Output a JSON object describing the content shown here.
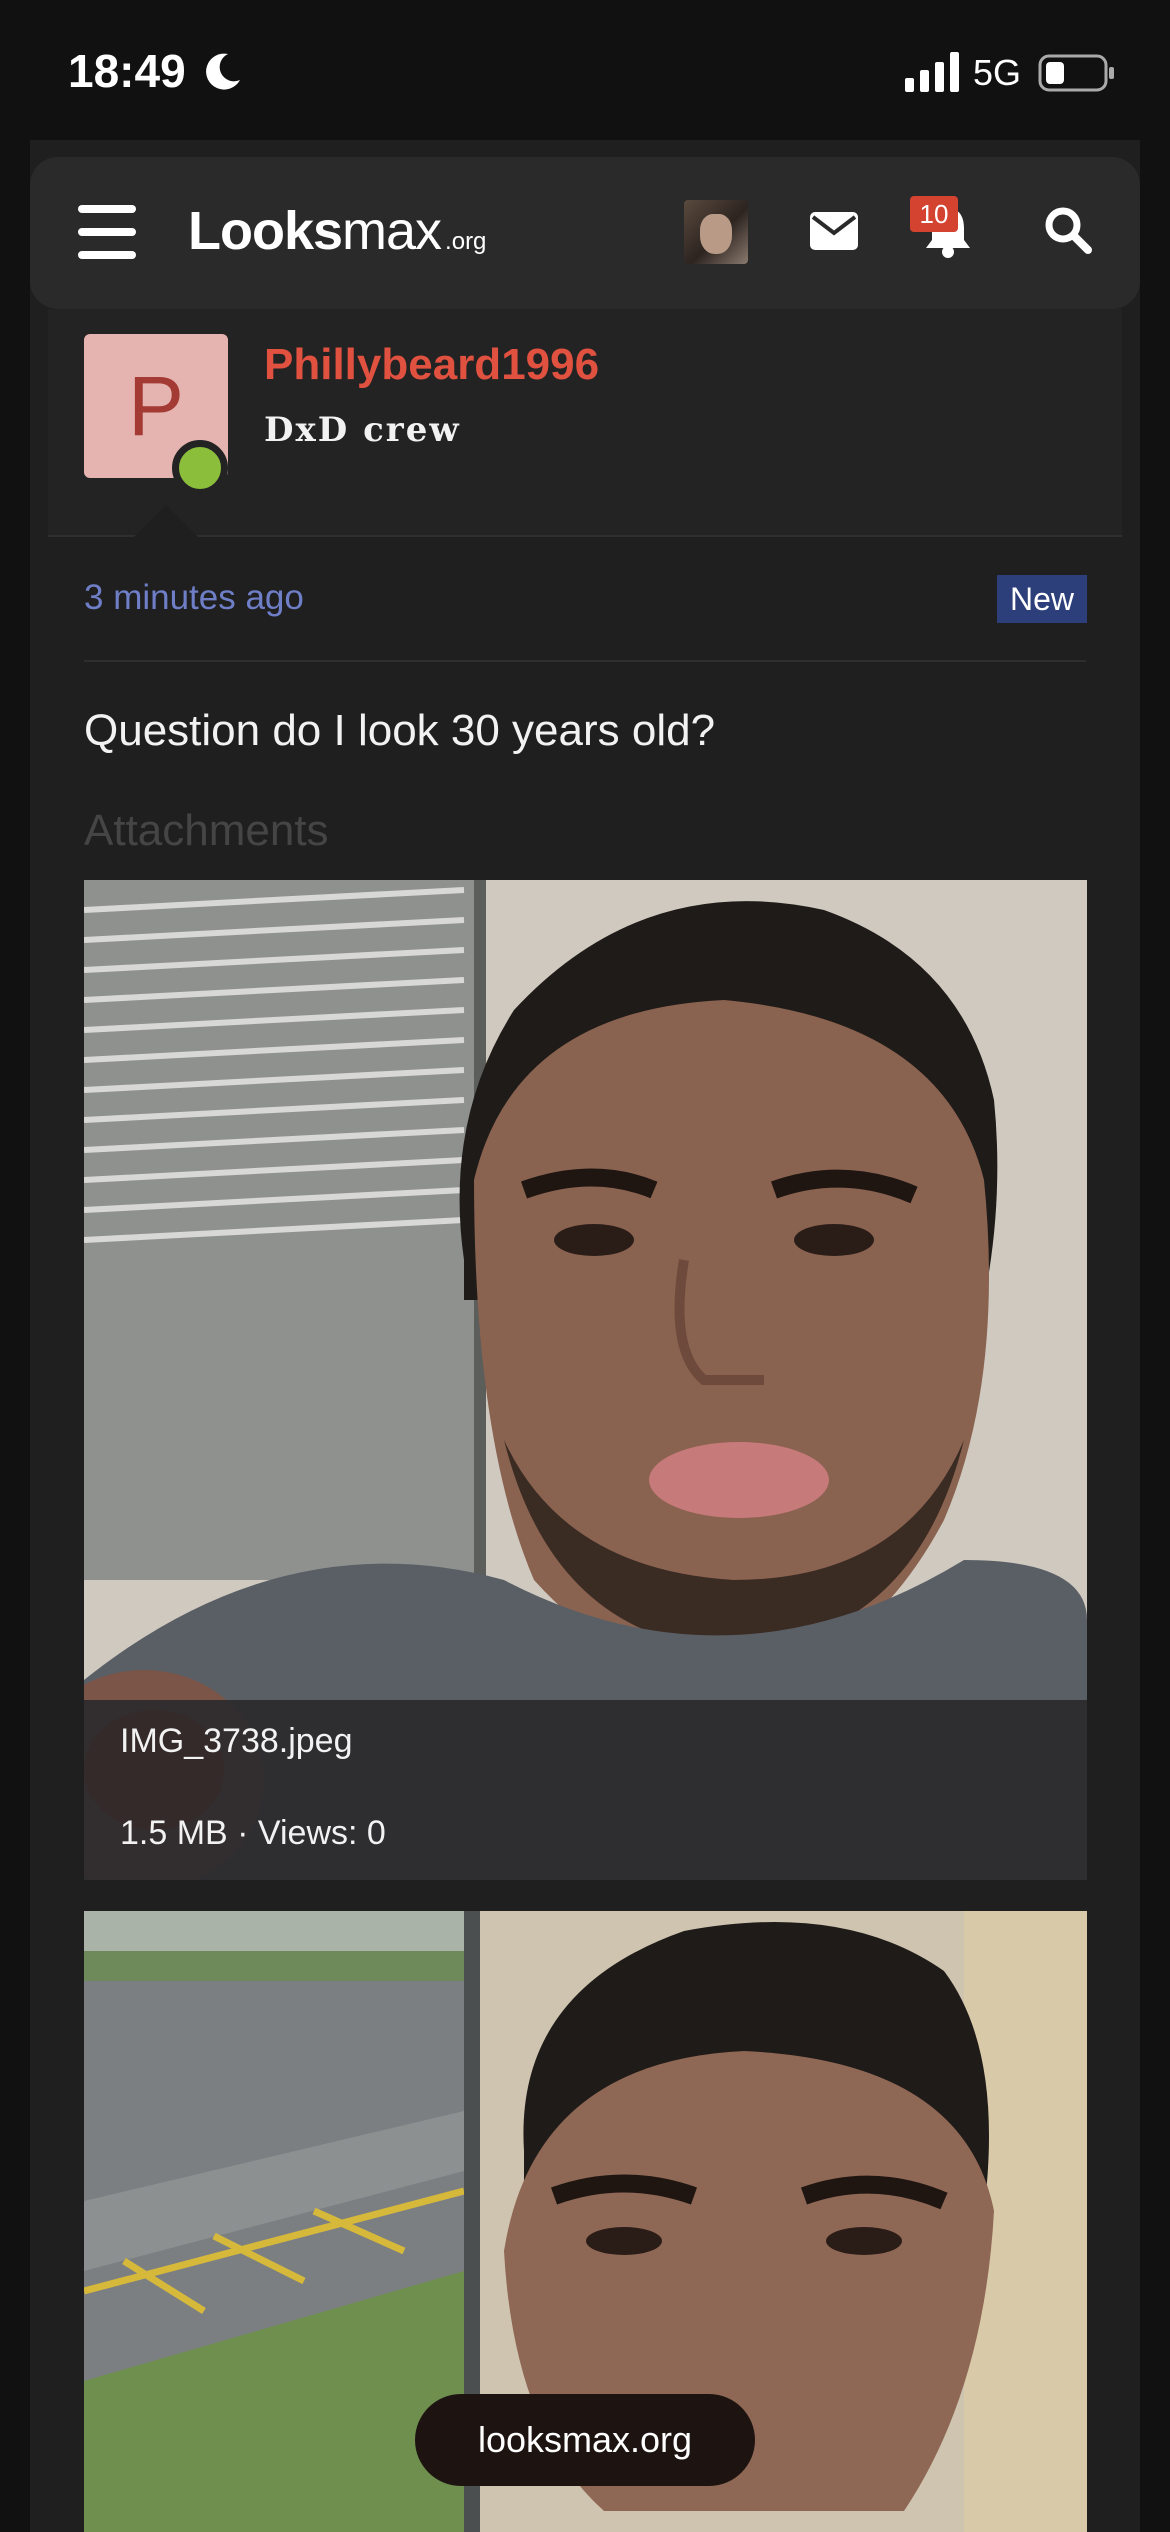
{
  "status_bar": {
    "time": "18:49",
    "network": "5G",
    "icons": [
      "moon-icon",
      "signal-icon",
      "battery-icon"
    ]
  },
  "navbar": {
    "logo_main": "Looks",
    "logo_max": "max",
    "logo_suffix": ".org",
    "notification_count": "10",
    "icons": [
      "hamburger-menu-icon",
      "mail-icon",
      "bell-icon",
      "search-icon"
    ]
  },
  "post": {
    "author": {
      "avatar_letter": "P",
      "username": "Phillybeard1996",
      "title": "DxD crew",
      "online": true
    },
    "time": "3 minutes ago",
    "badge": "New",
    "text": "Question do I look 30 years old?",
    "attachments_label": "Attachments",
    "attachments": [
      {
        "filename": "IMG_3738.jpeg",
        "meta": "1.5 MB · Views: 0"
      },
      {
        "filename": "",
        "meta": ""
      }
    ]
  },
  "footer_pill": "looksmax.org",
  "colors": {
    "username": "#e0513f",
    "time_link": "#6f7fc7",
    "new_badge": "#2d3f7a",
    "online": "#8bbe3a",
    "notification_badge": "#d44230"
  }
}
